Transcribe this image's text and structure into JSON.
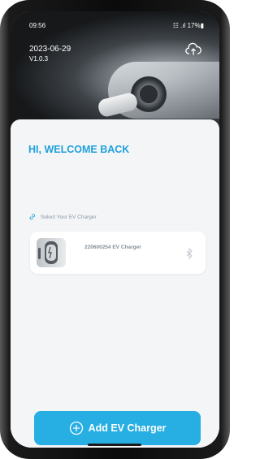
{
  "status_bar": {
    "time": "09:56",
    "system": "☷ .ıl 17%▮"
  },
  "header": {
    "date": "2023-06-29",
    "version": "V1.0.3",
    "cloud_icon": "cloud-upload-icon"
  },
  "main": {
    "welcome": "HI, WELCOME BACK",
    "select_label": "Select Your EV Charger",
    "charger": {
      "name": "220600254 EV Charger",
      "status_icon": "bluetooth-icon"
    },
    "add_button_label": "Add EV Charger"
  },
  "colors": {
    "accent": "#1ea0dc",
    "button": "#27aee3"
  }
}
